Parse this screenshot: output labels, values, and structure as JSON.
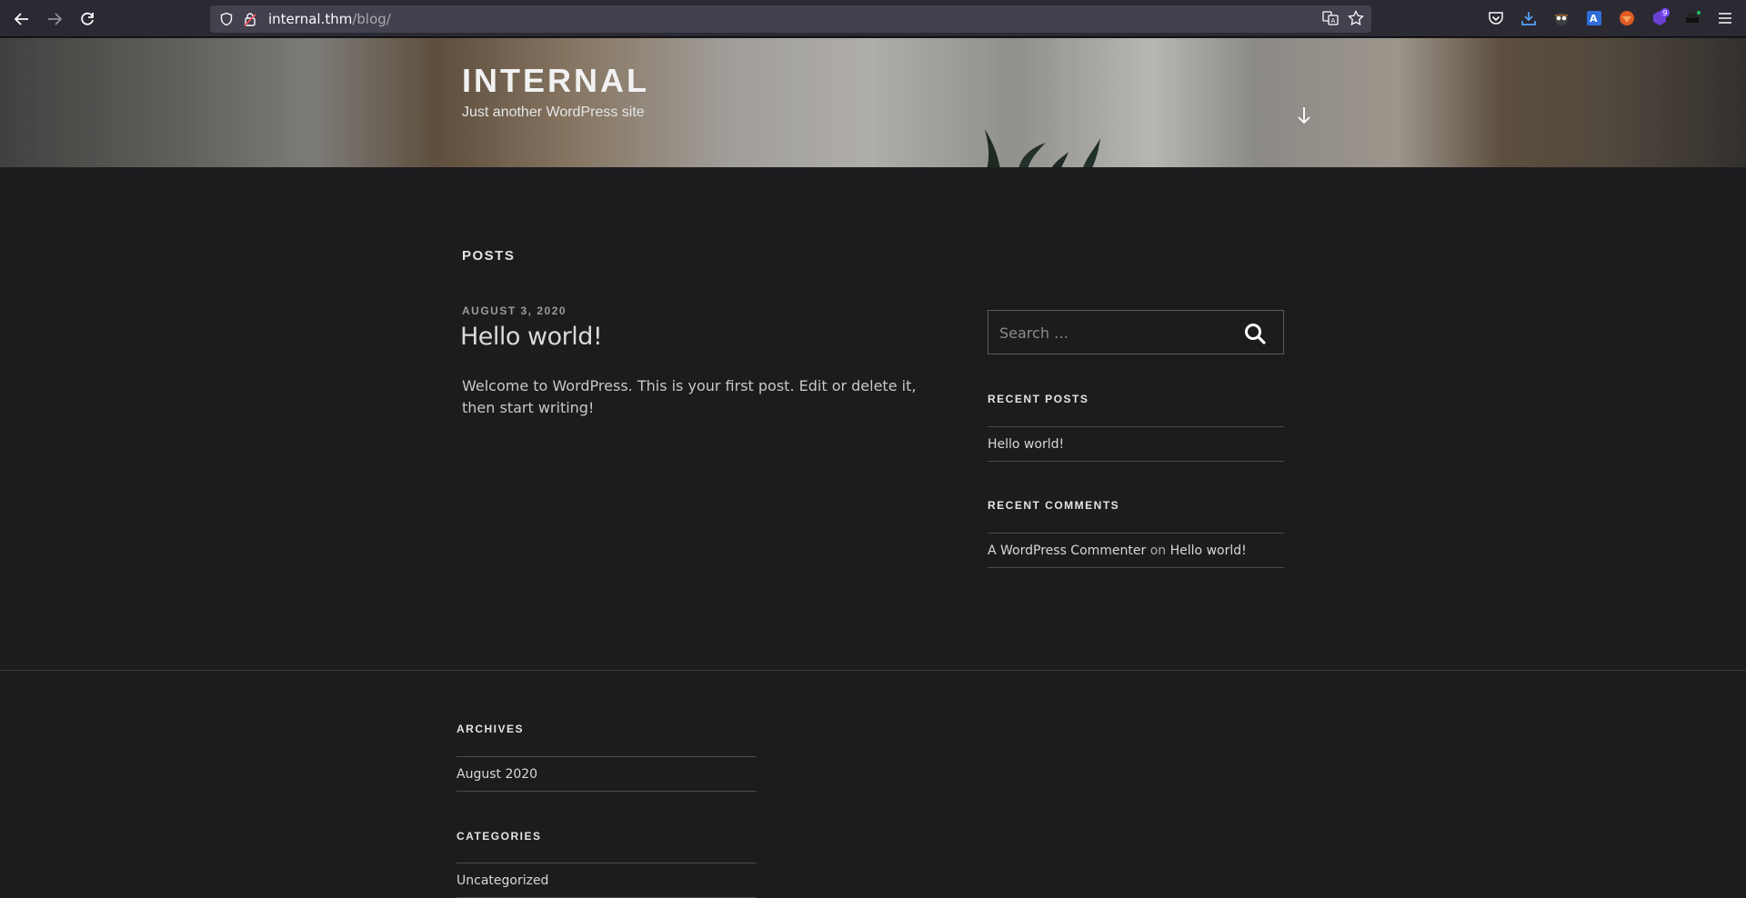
{
  "browser": {
    "url_host": "internal.thm",
    "url_path": "/blog/",
    "extension_badge": "9"
  },
  "site": {
    "title": "INTERNAL",
    "description": "Just another WordPress site"
  },
  "main": {
    "section_title": "POSTS",
    "post": {
      "date": "AUGUST 3, 2020",
      "title": "Hello world!",
      "excerpt": "Welcome to WordPress. This is your first post. Edit or delete it, then start writing!"
    }
  },
  "sidebar": {
    "search_placeholder": "Search …",
    "recent_posts_title": "RECENT POSTS",
    "recent_posts": [
      "Hello world!"
    ],
    "recent_comments_title": "RECENT COMMENTS",
    "comment_author": "A WordPress Commenter",
    "comment_on": "on",
    "comment_post": "Hello world!"
  },
  "footer": {
    "archives_title": "ARCHIVES",
    "archives": [
      "August 2020"
    ],
    "categories_title": "CATEGORIES",
    "categories": [
      "Uncategorized"
    ]
  }
}
